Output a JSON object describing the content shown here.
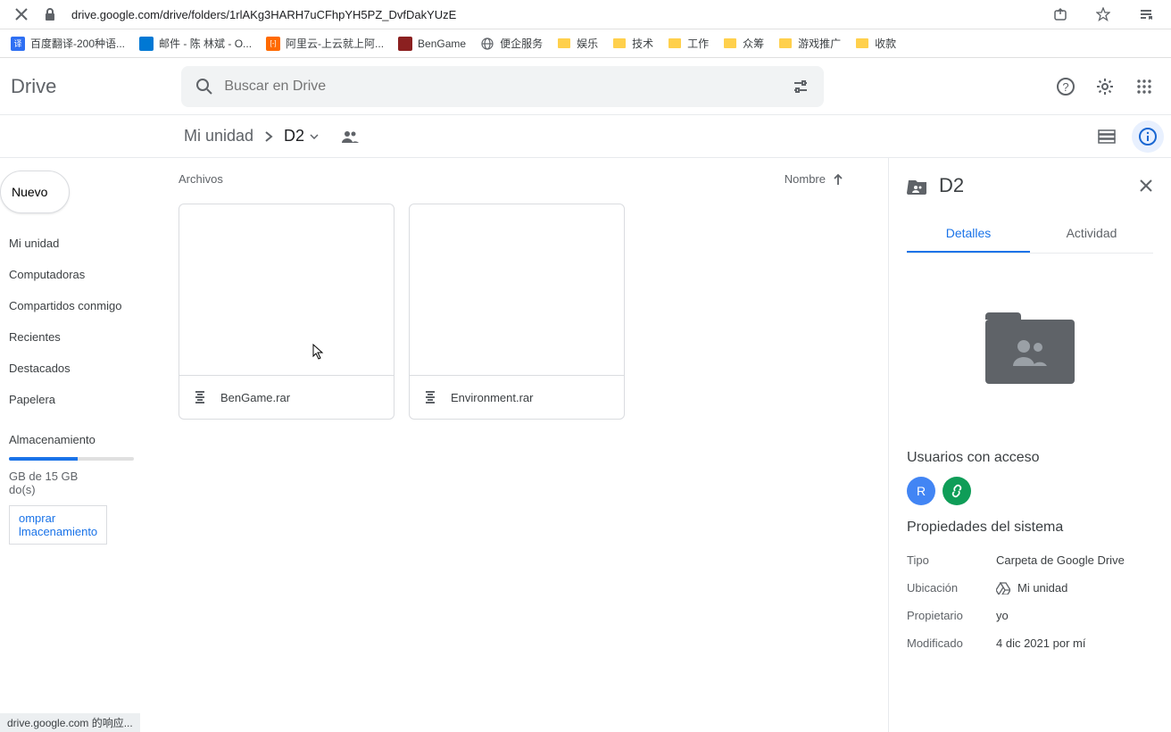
{
  "browser": {
    "url": "drive.google.com/drive/folders/1rlAKg3HARH7uCFhpYH5PZ_DvfDakYUzE",
    "status_text": "drive.google.com 的响应..."
  },
  "bookmarks": [
    {
      "label": "百度翻译-200种语...",
      "icon": "baidu"
    },
    {
      "label": "邮件 - 陈 林斌 - O...",
      "icon": "outlook"
    },
    {
      "label": "阿里云-上云就上阿...",
      "icon": "aliyun"
    },
    {
      "label": "BenGame",
      "icon": "bengame"
    },
    {
      "label": "便企服务",
      "icon": "globe"
    },
    {
      "label": "娱乐",
      "icon": "folder"
    },
    {
      "label": "技术",
      "icon": "folder"
    },
    {
      "label": "工作",
      "icon": "folder"
    },
    {
      "label": "众筹",
      "icon": "folder"
    },
    {
      "label": "游戏推广",
      "icon": "folder"
    },
    {
      "label": "收款",
      "icon": "folder"
    }
  ],
  "header": {
    "logo": "Drive",
    "search_placeholder": "Buscar en Drive"
  },
  "breadcrumb": {
    "root": "Mi unidad",
    "current": "D2"
  },
  "sidebar": {
    "new_label": "Nuevo",
    "items": [
      "Mi unidad",
      "Computadoras",
      "Compartidos conmigo",
      "Recientes",
      "Destacados",
      "Papelera"
    ],
    "storage_label": "Almacenamiento",
    "storage_text": "GB de 15 GB",
    "storage_text2": "do(s)",
    "storage_pct": 55,
    "buy_label1": "omprar",
    "buy_label2": "lmacenamiento"
  },
  "main": {
    "files_label": "Archivos",
    "sort_label": "Nombre",
    "files": [
      {
        "name": "BenGame.rar"
      },
      {
        "name": "Environment.rar"
      }
    ]
  },
  "details": {
    "title": "D2",
    "tabs": {
      "details": "Detalles",
      "activity": "Actividad"
    },
    "access_heading": "Usuarios con acceso",
    "avatar_letter": "R",
    "props_heading": "Propiedades del sistema",
    "props": {
      "type_label": "Tipo",
      "type_value": "Carpeta de Google Drive",
      "location_label": "Ubicación",
      "location_value": "Mi unidad",
      "owner_label": "Propietario",
      "owner_value": "yo",
      "modified_label": "Modificado",
      "modified_value": "4 dic 2021 por mí"
    }
  }
}
